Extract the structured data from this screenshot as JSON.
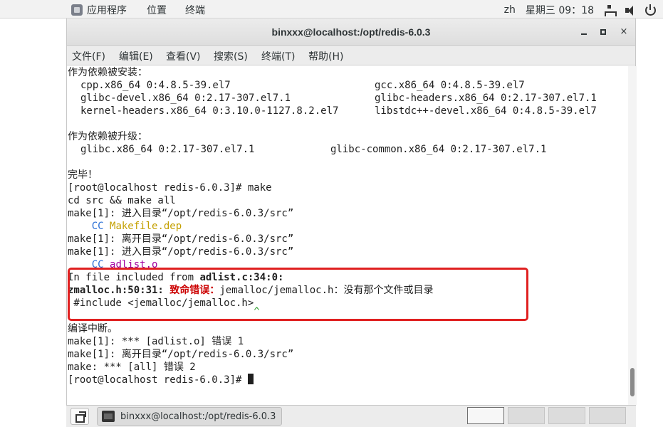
{
  "topbar": {
    "apps_label": "应用程序",
    "places_label": "位置",
    "terminal_label": "终端",
    "input_method": "zh",
    "datetime": "星期三 09：18"
  },
  "window": {
    "title": "binxxx@localhost:/opt/redis-6.0.3",
    "minimize": "",
    "maximize": "",
    "close": "×"
  },
  "menu": [
    "文件(F)",
    "编辑(E)",
    "查看(V)",
    "搜索(S)",
    "终端(T)",
    "帮助(H)"
  ],
  "terminal": {
    "dep_installed_header": "作为依赖被安装：",
    "dep_installed": [
      [
        "cpp.x86_64 0:4.8.5-39.el7",
        "gcc.x86_64 0:4.8.5-39.el7"
      ],
      [
        "glibc-devel.x86_64 0:2.17-307.el7.1",
        "glibc-headers.x86_64 0:2.17-307.el7.1"
      ],
      [
        "kernel-headers.x86_64 0:3.10.0-1127.8.2.el7",
        "libstdc++-devel.x86_64 0:4.8.5-39.el7"
      ]
    ],
    "dep_upgraded_header": "作为依赖被升级：",
    "dep_upgraded": [
      "glibc.x86_64 0:2.17-307.el7.1",
      "glibc-common.x86_64 0:2.17-307.el7.1"
    ],
    "done": "完毕！",
    "prompt1": "[root@localhost redis-6.0.3]# make",
    "line_cd": "cd src && make all",
    "line_enter1": "make[1]: 进入目录“/opt/redis-6.0.3/src”",
    "cc1_cmd": "    CC",
    "cc1_file": "Makefile.dep",
    "line_leave1": "make[1]: 离开目录“/opt/redis-6.0.3/src”",
    "line_enter2": "make[1]: 进入目录“/opt/redis-6.0.3/src”",
    "cc2_cmd": "    CC",
    "cc2_file": "adlist.o",
    "err_included_prefix": "In file included from ",
    "err_included_loc": "adlist.c:34:0:",
    "err_loc": "zmalloc.h:50:31: ",
    "err_fatal": "致命错误：",
    "err_msg": "jemalloc/jemalloc.h：没有那个文件或目录",
    "err_include": " #include <jemalloc/jemalloc.h>",
    "err_caret": "                               ^",
    "compile_abort": "编译中断。",
    "line_err1": "make[1]: *** [adlist.o] 错误 1",
    "line_leave2": "make[1]: 离开目录“/opt/redis-6.0.3/src”",
    "line_err2": "make: *** [all] 错误 2",
    "prompt2": "[root@localhost redis-6.0.3]# "
  },
  "taskbar": {
    "task_label": "binxxx@localhost:/opt/redis-6.0.3"
  }
}
